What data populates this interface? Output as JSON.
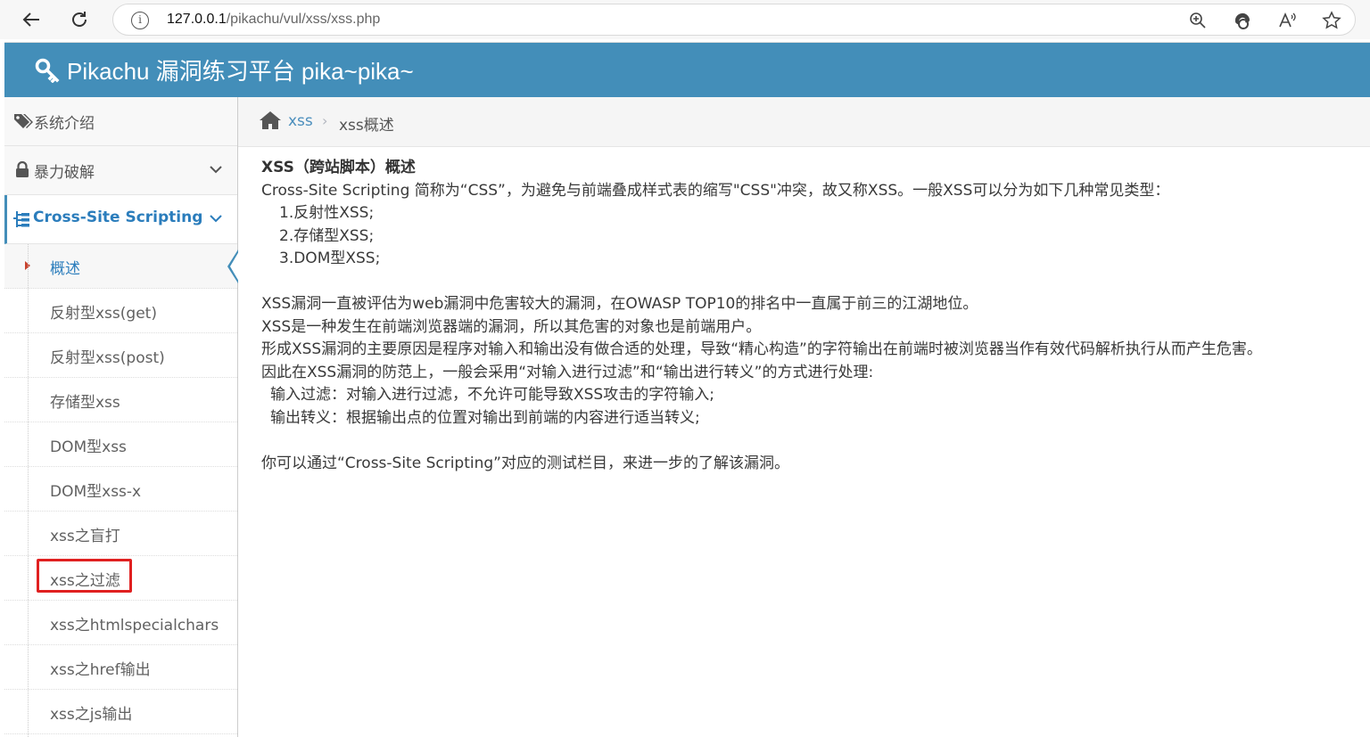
{
  "browser": {
    "url_host": "127.0.0.1",
    "url_path": "/pikachu/vul/xss/xss.php"
  },
  "header": {
    "title": "Pikachu 漏洞练习平台 pika~pika~"
  },
  "sidebar": {
    "items": [
      {
        "label": "系统介绍"
      },
      {
        "label": "暴力破解"
      },
      {
        "label": "Cross-Site Scripting"
      }
    ],
    "submenu": [
      {
        "label": "概述"
      },
      {
        "label": "反射型xss(get)"
      },
      {
        "label": "反射型xss(post)"
      },
      {
        "label": "存储型xss"
      },
      {
        "label": "DOM型xss"
      },
      {
        "label": "DOM型xss-x"
      },
      {
        "label": "xss之盲打"
      },
      {
        "label": "xss之过滤"
      },
      {
        "label": "xss之htmlspecialchars"
      },
      {
        "label": "xss之href输出"
      },
      {
        "label": "xss之js输出"
      }
    ]
  },
  "breadcrumb": {
    "link": "xss",
    "separator": "›",
    "current": "xss概述"
  },
  "content": {
    "title": "XSS（跨站脚本）概述",
    "lines": [
      "Cross-Site Scripting 简称为“CSS”，为避免与前端叠成样式表的缩写\"CSS\"冲突，故又称XSS。一般XSS可以分为如下几种常见类型：",
      "1.反射性XSS;",
      "2.存储型XSS;",
      "3.DOM型XSS;",
      "XSS漏洞一直被评估为web漏洞中危害较大的漏洞，在OWASP TOP10的排名中一直属于前三的江湖地位。",
      "XSS是一种发生在前端浏览器端的漏洞，所以其危害的对象也是前端用户。",
      "形成XSS漏洞的主要原因是程序对输入和输出没有做合适的处理，导致“精心构造”的字符输出在前端时被浏览器当作有效代码解析执行从而产生危害。",
      "因此在XSS漏洞的防范上，一般会采用“对输入进行过滤”和“输出进行转义”的方式进行处理:",
      "输入过滤：对输入进行过滤，不允许可能导致XSS攻击的字符输入;",
      "输出转义：根据输出点的位置对输出到前端的内容进行适当转义;",
      "你可以通过“Cross-Site Scripting”对应的测试栏目，来进一步的了解该漏洞。"
    ]
  },
  "colors": {
    "header_bg": "#438eb9",
    "link": "#2b7dbc",
    "highlight": "#e02020"
  }
}
